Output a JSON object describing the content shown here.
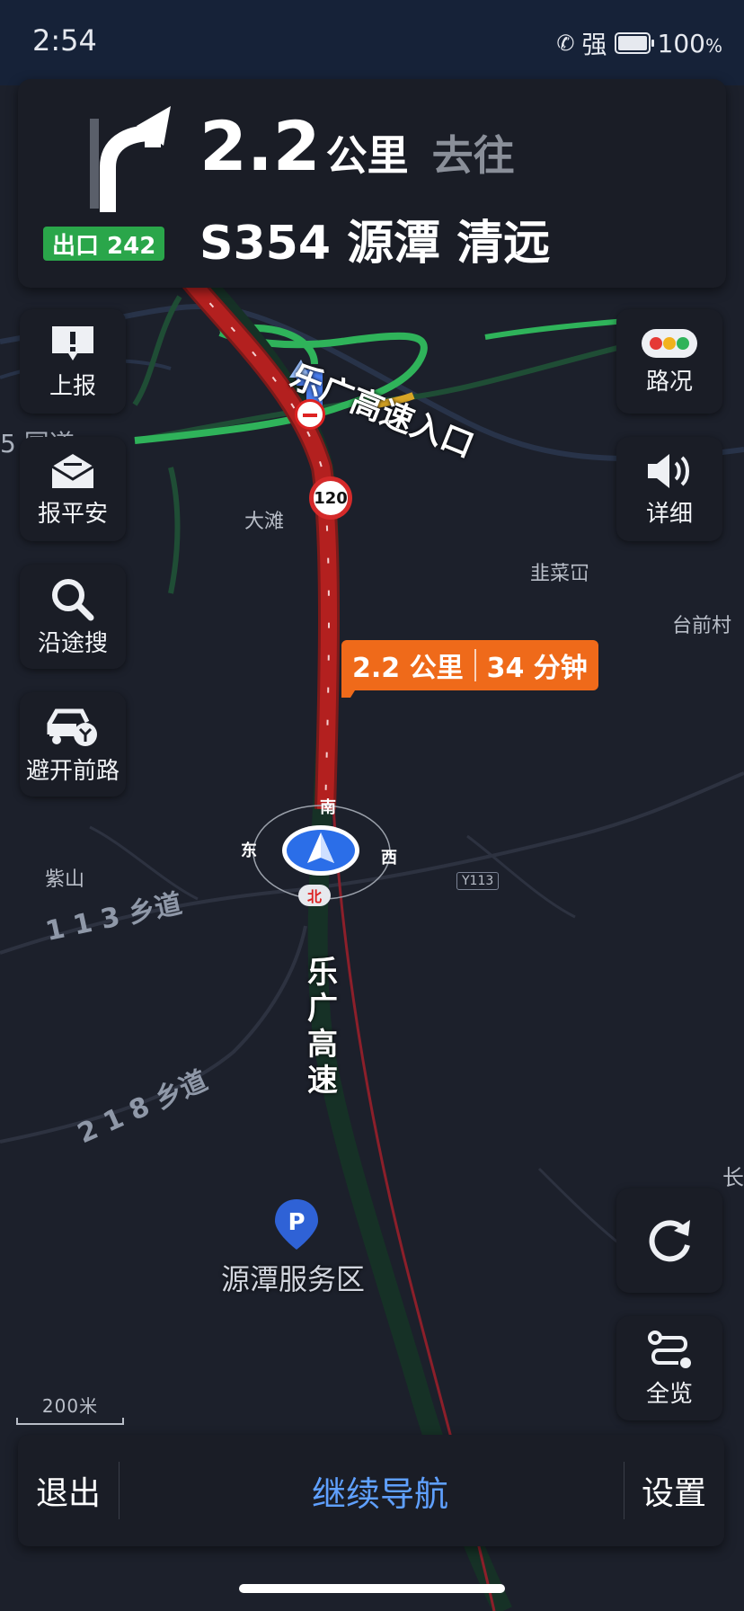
{
  "status": {
    "time": "2:54",
    "signal": "强",
    "battery": "100",
    "battery_unit": "%"
  },
  "guidance": {
    "exit": "出口 242",
    "distance": "2.2",
    "distance_unit": "公里",
    "direction_word": "去往",
    "road": "S354 源潭 清远"
  },
  "left_buttons": [
    {
      "label": "上报",
      "icon": "report-icon"
    },
    {
      "label": "报平安",
      "icon": "envelope-icon"
    },
    {
      "label": "沿途搜",
      "icon": "search-icon"
    },
    {
      "label": "避开前路",
      "icon": "car-avoid-icon"
    }
  ],
  "right_buttons": [
    {
      "label": "路况",
      "icon": "traffic-light-icon"
    },
    {
      "label": "详细",
      "icon": "speaker-icon"
    },
    {
      "label": "",
      "icon": "refresh-icon"
    },
    {
      "label": "全览",
      "icon": "route-overview-icon"
    }
  ],
  "eta": {
    "distance": "2.2 公里",
    "time": "34 分钟"
  },
  "map_labels": {
    "interchange": "乐广高速入口",
    "speed_limit": "120",
    "dadan": "大滩",
    "jiucai": "韭菜冚",
    "taiqian": "台前村",
    "zishan": "紫山",
    "road_113": "1 1 3 乡道",
    "road_218": "2 1 8 乡道",
    "y113": "Y113",
    "highway": "乐广高速",
    "service_area": "源潭服务区",
    "partial_left": "5 国道",
    "partial_right": "长"
  },
  "compass": {
    "north": "北",
    "south": "南",
    "east": "东",
    "west": "西"
  },
  "scale": "200米",
  "bottom": {
    "exit": "退出",
    "continue": "继续导航",
    "settings": "设置"
  },
  "colors": {
    "route_congested": "#b3201f",
    "route_clear": "#2fb35a",
    "eta": "#ef6a1a",
    "accent": "#5fa0ff"
  }
}
